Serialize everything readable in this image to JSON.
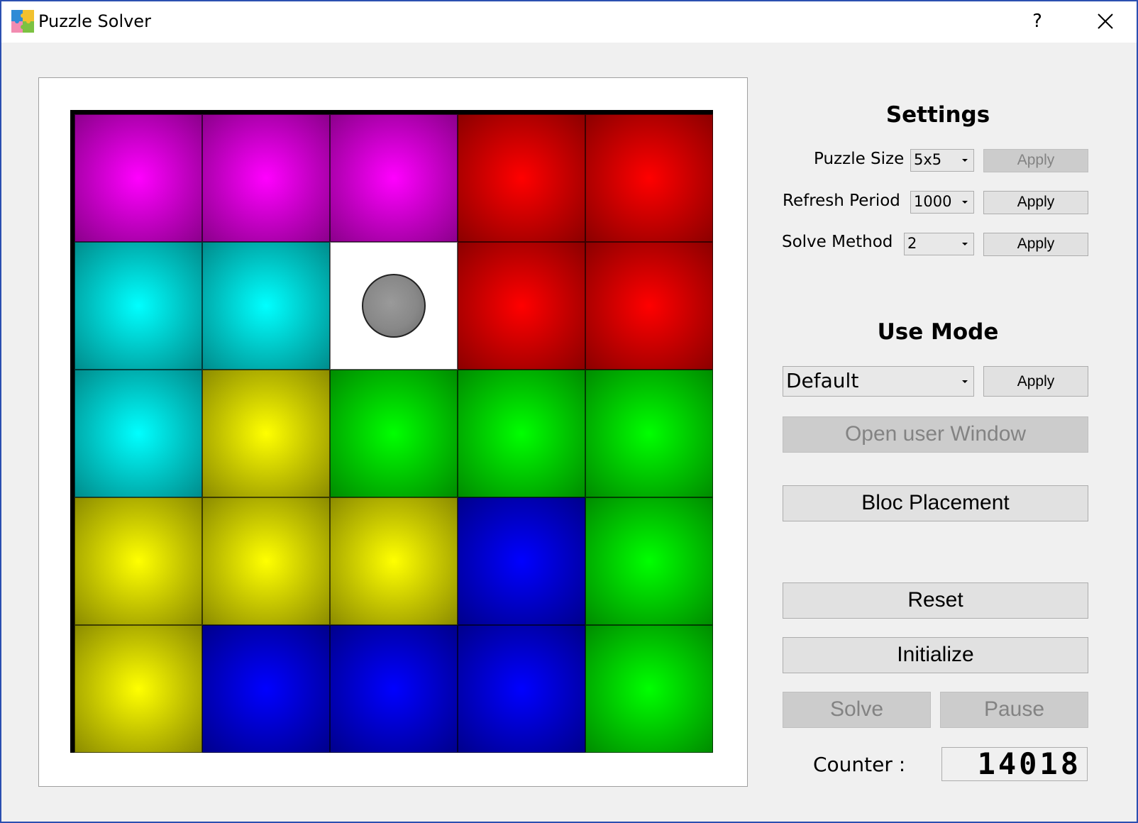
{
  "window": {
    "title": "Puzzle Solver",
    "help_label": "?"
  },
  "board": {
    "size": "5x5",
    "cells": [
      [
        "magenta",
        "magenta",
        "magenta",
        "red",
        "red"
      ],
      [
        "cyan",
        "cyan",
        "empty",
        "red",
        "red"
      ],
      [
        "cyan",
        "yellow",
        "green",
        "green",
        "green"
      ],
      [
        "yellow",
        "yellow",
        "yellow",
        "blue",
        "green"
      ],
      [
        "yellow",
        "blue",
        "blue",
        "blue",
        "green"
      ]
    ],
    "ball_cell": [
      1,
      2
    ],
    "colors": {
      "magenta": "#ff00ff",
      "red": "#ff0000",
      "cyan": "#00ffff",
      "yellow": "#ffff00",
      "green": "#00ff00",
      "blue": "#0000ff",
      "empty": "#ffffff",
      "ball": "#888888"
    }
  },
  "settings": {
    "title": "Settings",
    "puzzle_size": {
      "label": "Puzzle Size",
      "value": "5x5",
      "apply": "Apply",
      "apply_enabled": false
    },
    "refresh_period": {
      "label": "Refresh Period",
      "value": "1000",
      "apply": "Apply",
      "apply_enabled": true
    },
    "solve_method": {
      "label": "Solve Method",
      "value": "2",
      "apply": "Apply",
      "apply_enabled": true
    }
  },
  "use_mode": {
    "title": "Use Mode",
    "value": "Default",
    "apply": "Apply",
    "open_user_window": "Open user Window",
    "open_user_window_enabled": false,
    "bloc_placement": "Bloc Placement"
  },
  "controls": {
    "reset": "Reset",
    "initialize": "Initialize",
    "solve": "Solve",
    "solve_enabled": false,
    "pause": "Pause",
    "pause_enabled": false,
    "counter_label": "Counter :",
    "counter_value": "14018"
  },
  "icons": {
    "app": "puzzle-piece-icon",
    "close": "close-icon"
  }
}
